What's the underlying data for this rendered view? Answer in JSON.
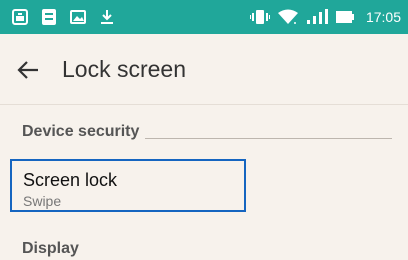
{
  "status_bar": {
    "time": "17:05",
    "left_icons": [
      "screenshot-icon",
      "document-icon",
      "image-icon",
      "download-icon"
    ],
    "right_icons": [
      "vibrate-icon",
      "wifi-icon",
      "signal-icon",
      "battery-icon"
    ],
    "color": "#20a79a"
  },
  "header": {
    "back_icon": "arrow-left-icon",
    "title": "Lock screen"
  },
  "sections": {
    "device_security": {
      "label": "Device security",
      "items": [
        {
          "title": "Screen lock",
          "summary": "Swipe"
        }
      ]
    },
    "display": {
      "label": "Display"
    }
  },
  "colors": {
    "focus_border": "#1565c0",
    "background": "#f7f2ec"
  }
}
